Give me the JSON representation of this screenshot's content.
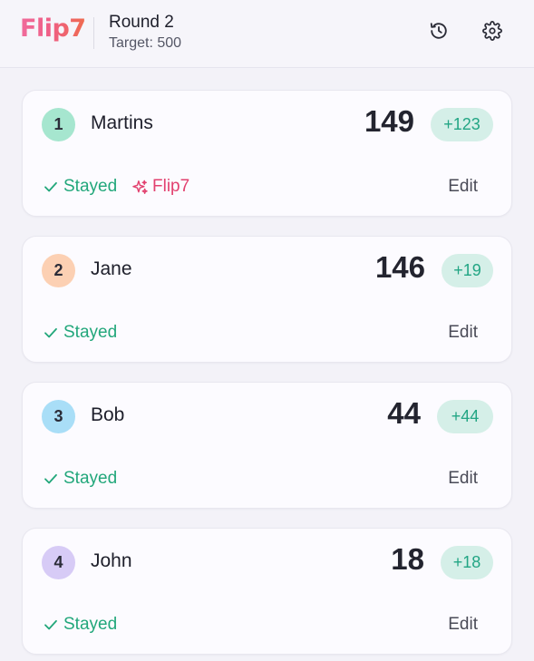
{
  "header": {
    "logo": "Flip7",
    "round_title": "Round 2",
    "target": "Target: 500",
    "icons": [
      "history-icon",
      "settings-icon"
    ]
  },
  "colors": {
    "accent_green": "#22a77b",
    "flip7_pink": "#e2416f",
    "delta_bg": "#d5efe8"
  },
  "players": [
    {
      "rank": "1",
      "name": "Martins",
      "total": "149",
      "delta": "+123",
      "status": "Stayed",
      "badge": "Flip7",
      "edit": "Edit",
      "rank_color": "#a6e6cf"
    },
    {
      "rank": "2",
      "name": "Jane",
      "total": "146",
      "delta": "+19",
      "status": "Stayed",
      "edit": "Edit",
      "rank_color": "#fcd0b3"
    },
    {
      "rank": "3",
      "name": "Bob",
      "total": "44",
      "delta": "+44",
      "status": "Stayed",
      "edit": "Edit",
      "rank_color": "#a9def7"
    },
    {
      "rank": "4",
      "name": "John",
      "total": "18",
      "delta": "+18",
      "status": "Stayed",
      "edit": "Edit",
      "rank_color": "#d7cbf6"
    }
  ]
}
